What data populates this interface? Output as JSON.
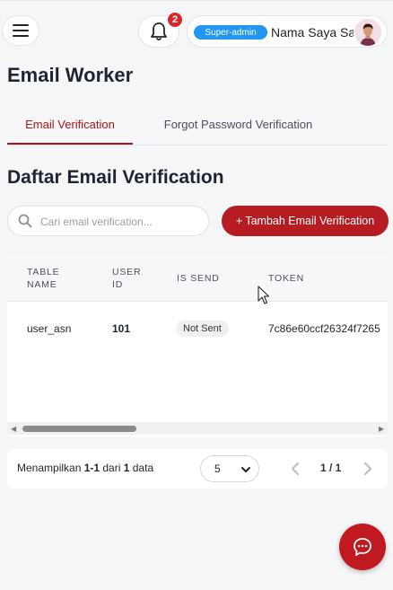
{
  "header": {
    "notification_count": "2",
    "role_badge": "Super-admin",
    "user_name": "Nama Saya Sa"
  },
  "page": {
    "title": "Email Worker"
  },
  "tabs": [
    {
      "label": "Email Verification",
      "active": true
    },
    {
      "label": "Forgot Password Verification",
      "active": false
    }
  ],
  "section": {
    "title": "Daftar Email Verification"
  },
  "search": {
    "placeholder": "Cari email verification..."
  },
  "actions": {
    "add_label": "+ Tambah Email Verification"
  },
  "table": {
    "columns": [
      {
        "line1": "TABLE",
        "line2": "NAME"
      },
      {
        "line1": "USER",
        "line2": "ID"
      },
      {
        "line1": "IS SEND",
        "line2": ""
      },
      {
        "line1": "TOKEN",
        "line2": ""
      }
    ],
    "rows": [
      {
        "table_name": "user_asn",
        "user_id": "101",
        "is_send": "Not Sent",
        "token": "7c86e60ccf26324f7265"
      }
    ]
  },
  "pagination": {
    "prefix": "Menampilkan ",
    "range": "1-1",
    "middle": " dari ",
    "total": "1",
    "suffix": " data",
    "page_size": "5",
    "page_indicator": "1 / 1"
  },
  "colors": {
    "primary": "#b71c22",
    "badge_blue": "#2196f3",
    "background": "#f5f6f8"
  }
}
